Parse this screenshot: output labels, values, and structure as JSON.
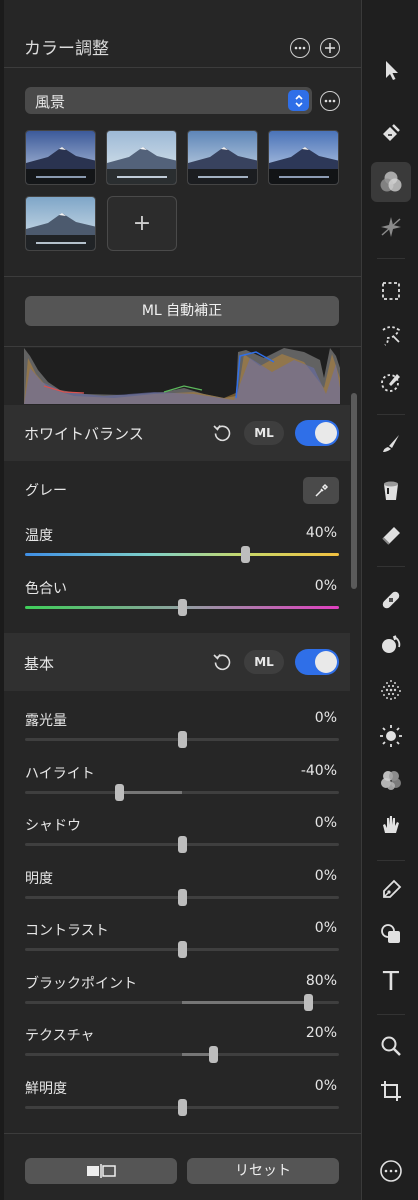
{
  "panel": {
    "title": "カラー調整",
    "preset": {
      "selected": "風景"
    },
    "add_thumb": "+",
    "ml_auto_button": "ML 自動補正",
    "white_balance": {
      "title": "ホワイトバランス",
      "ml": "ML",
      "enabled": true,
      "gray_label": "グレー",
      "sliders": [
        {
          "label": "温度",
          "value": "40%",
          "level": 40
        },
        {
          "label": "色合い",
          "value": "0%",
          "level": 0
        }
      ]
    },
    "basic": {
      "title": "基本",
      "ml": "ML",
      "enabled": true,
      "sliders": [
        {
          "label": "露光量",
          "value": "0%",
          "level": 0
        },
        {
          "label": "ハイライト",
          "value": "-40%",
          "level": -40
        },
        {
          "label": "シャドウ",
          "value": "0%",
          "level": 0
        },
        {
          "label": "明度",
          "value": "0%",
          "level": 0
        },
        {
          "label": "コントラスト",
          "value": "0%",
          "level": 0
        },
        {
          "label": "ブラックポイント",
          "value": "80%",
          "level": 80
        },
        {
          "label": "テクスチャ",
          "value": "20%",
          "level": 20
        },
        {
          "label": "鮮明度",
          "value": "0%",
          "level": 0
        }
      ]
    },
    "footer": {
      "compare_label": "■|□",
      "reset_label": "リセット"
    }
  },
  "colors": {
    "accent": "#2f6fe8",
    "panel_bg": "#262626",
    "section_bg": "#303030"
  },
  "toolbar_icons": [
    "select-arrow-icon",
    "paint-brush-bucket-icon",
    "color-adjust-icon",
    "sparkle-icon",
    "marquee-select-icon",
    "lasso-select-icon",
    "quick-select-icon",
    "brush-icon",
    "fill-bucket-icon",
    "eraser-icon",
    "bandage-heal-icon",
    "clone-stamp-icon",
    "noise-texture-icon",
    "light-sun-icon",
    "color-effects-icon",
    "smudge-hand-icon",
    "pen-tool-icon",
    "shape-icon",
    "text-tool-icon",
    "zoom-icon",
    "crop-icon",
    "more-options-icon"
  ],
  "toolbar": {
    "text_tool": "T",
    "more": "⋯"
  }
}
